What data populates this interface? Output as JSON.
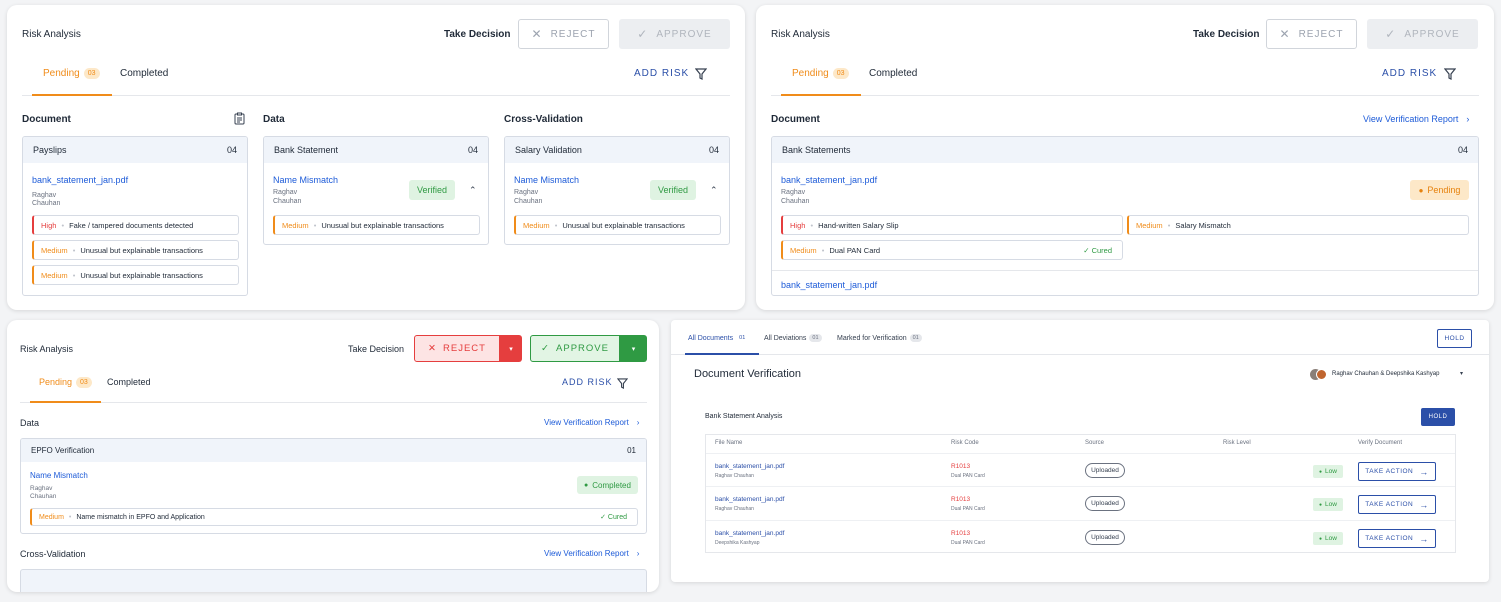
{
  "p1": {
    "title": "Risk Analysis",
    "take_decision": "Take Decision",
    "reject": "REJECT",
    "approve": "APPROVE",
    "tab_pending": "Pending",
    "pending_count": "03",
    "tab_completed": "Completed",
    "add_risk": "ADD RISK",
    "col_document": "Document",
    "col_data": "Data",
    "col_cross": "Cross-Validation",
    "card1": {
      "title": "Payslips",
      "count": "04",
      "file": "bank_statement_jan.pdf",
      "first": "Raghav",
      "last": "Chauhan",
      "risks": [
        {
          "level": "High",
          "text": "Fake / tampered documents detected"
        },
        {
          "level": "Medium",
          "text": "Unusual but explainable transactions"
        },
        {
          "level": "Medium",
          "text": "Unusual but explainable transactions"
        }
      ]
    },
    "card2": {
      "title": "Bank Statement",
      "count": "04",
      "link": "Name Mismatch",
      "first": "Raghav",
      "last": "Chauhan",
      "status": "Verified",
      "risk_level": "Medium",
      "risk_text": "Unusual but explainable transactions"
    },
    "card3": {
      "title": "Salary Validation",
      "count": "04",
      "link": "Name Mismatch",
      "first": "Raghav",
      "last": "Chauhan",
      "status": "Verified",
      "risk_level": "Medium",
      "risk_text": "Unusual but explainable transactions"
    }
  },
  "p2": {
    "title": "Risk Analysis",
    "take_decision": "Take Decision",
    "reject": "REJECT",
    "approve": "APPROVE",
    "tab_pending": "Pending",
    "pending_count": "03",
    "tab_completed": "Completed",
    "add_risk": "ADD RISK",
    "section": "Document",
    "view_report": "View Verification Report",
    "card": {
      "title": "Bank Statements",
      "count": "04",
      "file": "bank_statement_jan.pdf",
      "first": "Raghav",
      "last": "Chauhan",
      "status": "Pending",
      "risks": [
        {
          "level": "High",
          "text": "Hand-written Salary Slip"
        },
        {
          "level": "Medium",
          "text": "Salary Mismatch"
        },
        {
          "level": "Medium",
          "text": "Dual PAN Card",
          "cured": "Cured"
        }
      ],
      "file2": "bank_statement_jan.pdf"
    }
  },
  "p3": {
    "title": "Risk Analysis",
    "take_decision": "Take Decision",
    "reject": "REJECT",
    "approve": "APPROVE",
    "tab_pending": "Pending",
    "pending_count": "03",
    "tab_completed": "Completed",
    "add_risk": "ADD RISK",
    "section_data": "Data",
    "view_report": "View Verification Report",
    "card": {
      "title": "EPFO Verification",
      "count": "01",
      "link": "Name Mismatch",
      "first": "Raghav",
      "last": "Chauhan",
      "status": "Completed",
      "risk_level": "Medium",
      "risk_text": "Name mismatch in EPFO and Application",
      "cured": "Cured"
    },
    "section_cross": "Cross-Validation",
    "view_report2": "View Verification Report"
  },
  "p4": {
    "tabs": [
      {
        "label": "All Documents",
        "count": "01"
      },
      {
        "label": "All Deviations",
        "count": "01"
      },
      {
        "label": "Marked for Verification",
        "count": "01"
      }
    ],
    "hold_top": "HOLD",
    "title": "Document Verification",
    "users": "Raghav Chauhan & Deepshika Kashyap",
    "analysis_title": "Bank Statement Analysis",
    "hold": "HOLD",
    "columns": [
      "File Name",
      "Risk Code",
      "Source",
      "Risk Level",
      "Verify Document"
    ],
    "rows": [
      {
        "file": "bank_statement_jan.pdf",
        "owner": "Raghav Chauhan",
        "code": "R1013",
        "code_desc": "Dual PAN Card",
        "source": "Uploaded",
        "level": "Low",
        "action": "TAKE ACTION"
      },
      {
        "file": "bank_statement_jan.pdf",
        "owner": "Raghav Chauhan",
        "code": "R1013",
        "code_desc": "Dual PAN Card",
        "source": "Uploaded",
        "level": "Low",
        "action": "TAKE ACTION"
      },
      {
        "file": "bank_statement_jan.pdf",
        "owner": "Deepshika Kashyap",
        "code": "R1013",
        "code_desc": "Dual PAN Card",
        "source": "Uploaded",
        "level": "Low",
        "action": "TAKE ACTION"
      }
    ]
  },
  "colors": {
    "accent": "#f08c1a",
    "link": "#1d5bd8",
    "success": "#2f9a43",
    "danger": "#e53e3e",
    "primary": "#2b4fa8"
  }
}
